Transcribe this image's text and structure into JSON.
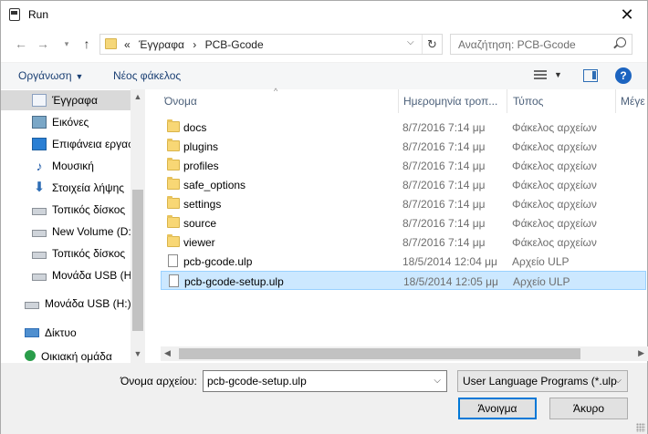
{
  "window": {
    "title": "Run"
  },
  "address": {
    "overflow": "«",
    "crumbs": [
      "Έγγραφα",
      "PCB-Gcode"
    ],
    "separator": "›"
  },
  "search": {
    "placeholder": "Αναζήτηση: PCB-Gcode"
  },
  "toolbar": {
    "organize_label": "Οργάνωση",
    "new_folder_label": "Νέος φάκελος",
    "help_label": "?"
  },
  "sidebar": {
    "items": [
      {
        "label": "Έγγραφα",
        "icon": "documents-icon",
        "selected": true
      },
      {
        "label": "Εικόνες",
        "icon": "pictures-icon"
      },
      {
        "label": "Επιφάνεια εργασ",
        "icon": "desktop-icon"
      },
      {
        "label": "Μουσική",
        "icon": "music-icon"
      },
      {
        "label": "Στοιχεία λήψης",
        "icon": "downloads-icon"
      },
      {
        "label": "Τοπικός δίσκος",
        "icon": "disk-icon"
      },
      {
        "label": "New Volume (D:",
        "icon": "disk-icon"
      },
      {
        "label": "Τοπικός δίσκος",
        "icon": "disk-icon"
      },
      {
        "label": "Μονάδα USB (H",
        "icon": "usb-drive-icon"
      },
      {
        "label": "Μονάδα USB (H:)",
        "icon": "usb-drive-icon"
      },
      {
        "label": "Δίκτυο",
        "icon": "network-icon"
      },
      {
        "label": "Οικιακή ομάδα",
        "icon": "homegroup-icon"
      }
    ]
  },
  "filelist": {
    "columns": [
      "Όνομα",
      "Ημερομηνία τροπ...",
      "Τύπος",
      "Μέγε"
    ],
    "rows": [
      {
        "name": "docs",
        "date": "8/7/2016 7:14 μμ",
        "type": "Φάκελος αρχείων",
        "kind": "folder"
      },
      {
        "name": "plugins",
        "date": "8/7/2016 7:14 μμ",
        "type": "Φάκελος αρχείων",
        "kind": "folder"
      },
      {
        "name": "profiles",
        "date": "8/7/2016 7:14 μμ",
        "type": "Φάκελος αρχείων",
        "kind": "folder"
      },
      {
        "name": "safe_options",
        "date": "8/7/2016 7:14 μμ",
        "type": "Φάκελος αρχείων",
        "kind": "folder"
      },
      {
        "name": "settings",
        "date": "8/7/2016 7:14 μμ",
        "type": "Φάκελος αρχείων",
        "kind": "folder"
      },
      {
        "name": "source",
        "date": "8/7/2016 7:14 μμ",
        "type": "Φάκελος αρχείων",
        "kind": "folder"
      },
      {
        "name": "viewer",
        "date": "8/7/2016 7:14 μμ",
        "type": "Φάκελος αρχείων",
        "kind": "folder"
      },
      {
        "name": "pcb-gcode.ulp",
        "date": "18/5/2014 12:04 μμ",
        "type": "Αρχείο ULP",
        "kind": "file"
      },
      {
        "name": "pcb-gcode-setup.ulp",
        "date": "18/5/2014 12:05 μμ",
        "type": "Αρχείο ULP",
        "kind": "file",
        "selected": true
      }
    ]
  },
  "bottom": {
    "filename_label": "Όνομα αρχείου:",
    "filename_value": "pcb-gcode-setup.ulp",
    "filter_value": "User Language Programs (*.ulp",
    "open_label": "Άνοιγμα",
    "cancel_label": "Άκυρο"
  }
}
